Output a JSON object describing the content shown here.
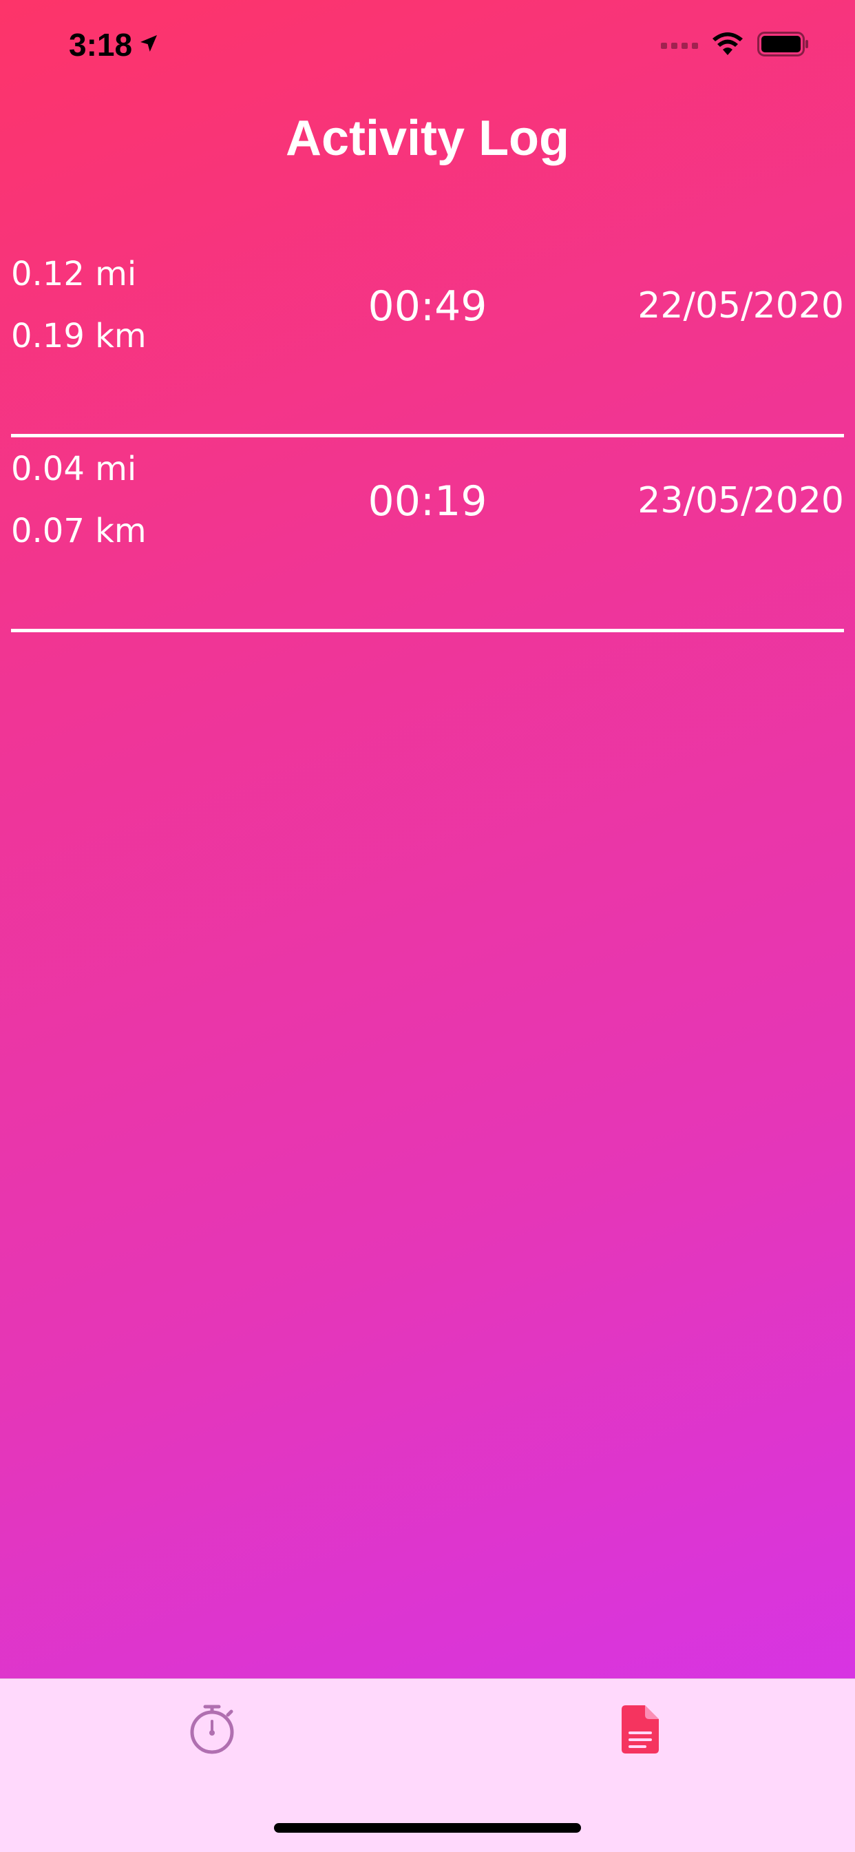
{
  "status_bar": {
    "time": "3:18",
    "location_icon": "location-arrow-icon",
    "wifi_icon": "wifi-icon",
    "battery_icon": "battery-icon"
  },
  "header": {
    "title": "Activity Log"
  },
  "activities": [
    {
      "distance_mi": "0.12 mi",
      "distance_km": "0.19 km",
      "duration": "00:49",
      "date": "22/05/2020"
    },
    {
      "distance_mi": "0.04 mi",
      "distance_km": "0.07 km",
      "duration": "00:19",
      "date": "23/05/2020"
    }
  ],
  "tab_bar": {
    "tabs": [
      {
        "icon": "stopwatch-icon",
        "selected": false,
        "color": "#b06fb0"
      },
      {
        "icon": "document-icon",
        "selected": true,
        "color": "#f5345f"
      }
    ],
    "background": "#ffd9fc"
  },
  "colors": {
    "gradient_start": "#fd3469",
    "gradient_end": "#d334ef",
    "text": "#ffffff"
  }
}
